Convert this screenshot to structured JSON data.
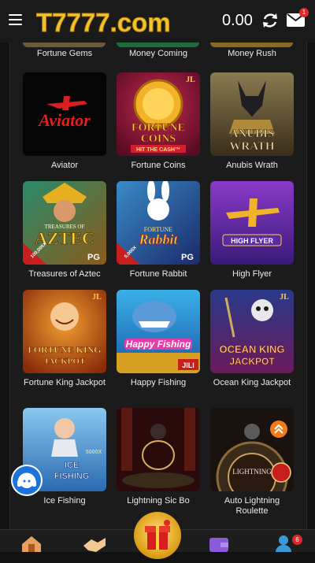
{
  "header": {
    "logo_text": "T7777.com",
    "balance": "0.00",
    "mail_badge": "1",
    "icons": [
      "menu-icon",
      "refresh-icon",
      "mail-icon"
    ]
  },
  "top_row": [
    "Fortune Gems",
    "Money Coming",
    "Money Rush"
  ],
  "games": [
    {
      "label": "Aviator"
    },
    {
      "label": "Fortune Coins"
    },
    {
      "label": "Anubis Wrath"
    },
    {
      "label": "Treasures of Aztec"
    },
    {
      "label": "Fortune Rabbit"
    },
    {
      "label": "High Flyer"
    },
    {
      "label": "Fortune King Jackpot"
    },
    {
      "label": "Happy Fishing"
    },
    {
      "label": "Ocean King Jackpot"
    },
    {
      "label": "Ice Fishing"
    },
    {
      "label": "Lightning Sic Bo"
    },
    {
      "label": "Auto Lightning Roulette"
    }
  ],
  "art": {
    "aviator": "Aviator",
    "fortune_coins_1": "FORTUNE",
    "fortune_coins_2": "COINS",
    "fortune_coins_3": "HIT THE CASH™",
    "jl": "JL",
    "anubis_1": "ANUBIS",
    "anubis_2": "WRATH",
    "aztec_1": "TREASURES OF",
    "aztec_2": "AZTEC",
    "pg": "PG",
    "aztec_badge": "100,000X",
    "rabbit_1": "FORTUNE",
    "rabbit_2": "Rabbit",
    "rabbit_badge": "5,000X",
    "highflyer": "HIGH FLYER",
    "fking_1": "FORTUNE KING",
    "fking_2": "JACKPOT",
    "happy_fishing": "Happy Fishing",
    "jili": "JILI",
    "ocean_1": "OCEAN KING",
    "ocean_2": "JACKPOT",
    "ice_1": "ICE",
    "ice_2": "FISHING",
    "ice_3": "5000X",
    "lightning": "LIGHTNING"
  },
  "bottom_nav": {
    "badge": "6"
  },
  "colors": {
    "accent_orange": "#f07a1a",
    "badge_red": "#e02828",
    "support_blue": "#1e73d8",
    "gift_gold": "#e0a420"
  }
}
